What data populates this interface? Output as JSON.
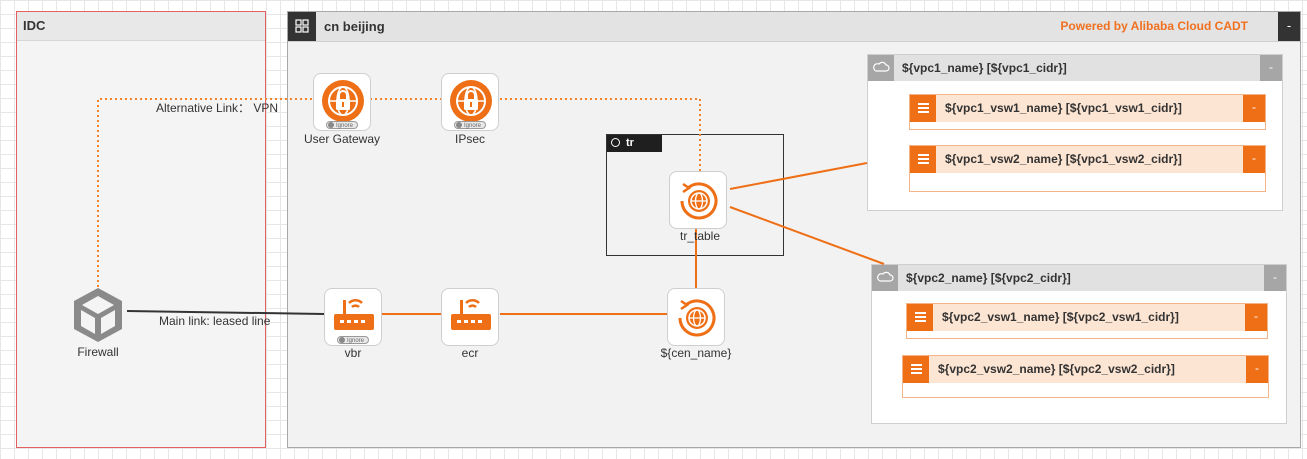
{
  "zones": {
    "idc": {
      "title": "IDC"
    },
    "region": {
      "title": "cn beijing",
      "powered_by": "Powered by Alibaba Cloud CADT",
      "collapse": "-"
    },
    "tr": {
      "title": "tr"
    }
  },
  "vpcs": [
    {
      "title": "${vpc1_name} [${vpc1_cidr}]",
      "collapse": "-",
      "vsws": [
        {
          "title": "${vpc1_vsw1_name} [${vpc1_vsw1_cidr}]",
          "collapse": "-"
        },
        {
          "title": "${vpc1_vsw2_name} [${vpc1_vsw2_cidr}]",
          "collapse": "-"
        }
      ]
    },
    {
      "title": "${vpc2_name} [${vpc2_cidr}]",
      "collapse": "-",
      "vsws": [
        {
          "title": "${vpc2_vsw1_name} [${vpc2_vsw1_cidr}]",
          "collapse": "-"
        },
        {
          "title": "${vpc2_vsw2_name} [${vpc2_vsw2_cidr}]",
          "collapse": "-"
        }
      ]
    }
  ],
  "nodes": {
    "firewall": {
      "label": "Firewall",
      "icon": "firewall-icon"
    },
    "user_gateway": {
      "label": "User Gateway",
      "icon": "vpn-gateway-icon",
      "badge": "Ignore"
    },
    "ipsec": {
      "label": "IPsec",
      "icon": "ipsec-icon",
      "badge": "Ignore"
    },
    "vbr": {
      "label": "vbr",
      "icon": "router-icon",
      "badge": "Ignore"
    },
    "ecr": {
      "label": "ecr",
      "icon": "router-icon"
    },
    "cen": {
      "label": "${cen_name}",
      "icon": "cen-globe-icon"
    },
    "tr_table": {
      "label": "tr_table",
      "icon": "cen-globe-icon"
    }
  },
  "links": {
    "vpn": {
      "label": "Alternative Link： VPN"
    },
    "main": {
      "label": "Main link: leased line"
    }
  },
  "colors": {
    "accent": "#ee6f15",
    "link_main": "#333333",
    "idc_border": "#e46060"
  }
}
